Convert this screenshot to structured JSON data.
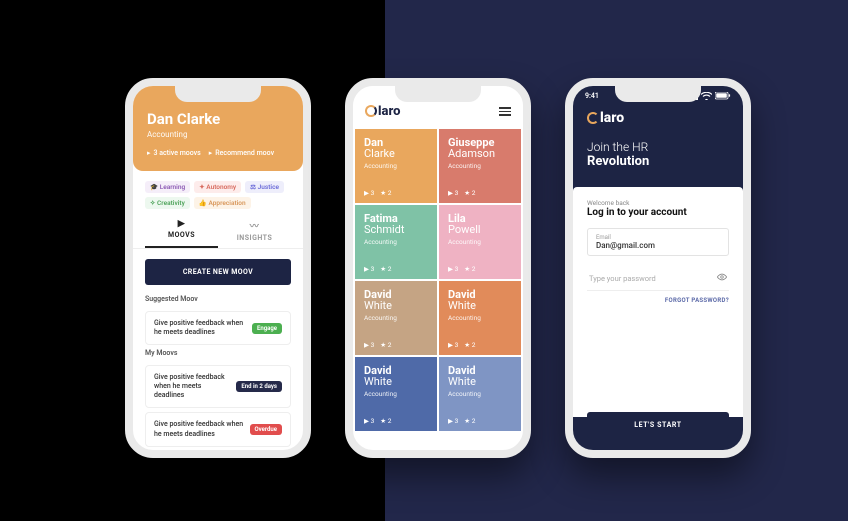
{
  "brand": "laro",
  "phone1": {
    "name": "Dan Clarke",
    "sub": "Accounting",
    "metric_a": "3 active moovs",
    "metric_b": "Recommend moov",
    "chips": [
      {
        "label": "Learning",
        "bg": "#f5eef9",
        "fg": "#8d5bb5",
        "icon": "🎓"
      },
      {
        "label": "Autonomy",
        "bg": "#fdeceb",
        "fg": "#d86b5f",
        "icon": "✦"
      },
      {
        "label": "Justice",
        "bg": "#eeeefb",
        "fg": "#6b6bd8",
        "icon": "⚖"
      },
      {
        "label": "Creativity",
        "bg": "#edf8ef",
        "fg": "#4ea35a",
        "icon": "✧"
      },
      {
        "label": "Appreciation",
        "bg": "#fdf3e7",
        "fg": "#d8975b",
        "icon": "👍"
      }
    ],
    "tabs": {
      "moovs": "MOOVS",
      "insights": "INSIGHTS"
    },
    "cta": "CREATE NEW MOOV",
    "section_suggested": "Suggested Moov",
    "section_my": "My Moovs",
    "cards": [
      {
        "text": "Give positive feedback when he meets deadlines",
        "badge": "Engage",
        "cls": "b-green"
      },
      {
        "text": "Give positive feedback when he meets deadlines",
        "badge": "End in 2 days",
        "cls": "b-navy"
      },
      {
        "text": "Give positive feedback when he meets deadlines",
        "badge": "Overdue",
        "cls": "b-red"
      }
    ]
  },
  "phone2": {
    "people": [
      {
        "first": "Dan",
        "last": "Clarke",
        "role": "Accounting",
        "a": "3",
        "b": "2",
        "bg": "#e9a75d"
      },
      {
        "first": "Giuseppe",
        "last": "Adamson",
        "role": "Accounting",
        "a": "3",
        "b": "2",
        "bg": "#d87b6c"
      },
      {
        "first": "Fatima",
        "last": "Schmidt",
        "role": "Accounting",
        "a": "3",
        "b": "2",
        "bg": "#7fc2a6"
      },
      {
        "first": "Lila",
        "last": "Powell",
        "role": "Accounting",
        "a": "3",
        "b": "2",
        "bg": "#efb2c3"
      },
      {
        "first": "David",
        "last": "White",
        "role": "Accounting",
        "a": "3",
        "b": "2",
        "bg": "#c5a484"
      },
      {
        "first": "David",
        "last": "White",
        "role": "Accounting",
        "a": "3",
        "b": "2",
        "bg": "#e18b5a"
      },
      {
        "first": "David",
        "last": "White",
        "role": "Accounting",
        "a": "3",
        "b": "2",
        "bg": "#4f6aa8"
      },
      {
        "first": "David",
        "last": "White",
        "role": "Accounting",
        "a": "3",
        "b": "2",
        "bg": "#7f95c4"
      }
    ]
  },
  "phone3": {
    "time": "9:41",
    "hero_l1": "Join the HR",
    "hero_l2": "Revolution",
    "welcome": "Welcome back",
    "title": "Log in to your account",
    "email_label": "Email",
    "email_value": "Dan@gmail.com",
    "password_placeholder": "Type your password",
    "forgot": "FORGOT PASSWORD?",
    "start": "LET'S START"
  }
}
